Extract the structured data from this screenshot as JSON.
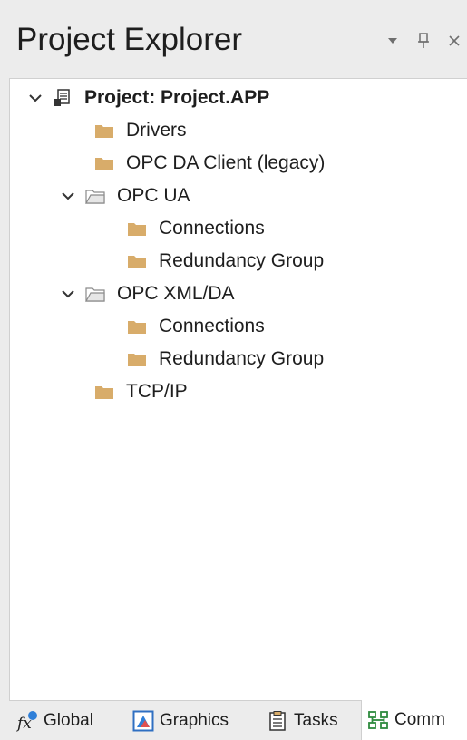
{
  "panel": {
    "title": "Project Explorer",
    "header_buttons": [
      {
        "name": "dropdown-icon"
      },
      {
        "name": "pin-icon"
      },
      {
        "name": "close-icon"
      }
    ]
  },
  "tree": {
    "root": {
      "label": "Project: Project.APP",
      "icon": "project-icon",
      "expanded": true
    },
    "items": [
      {
        "label": "Drivers",
        "icon": "folder-icon"
      },
      {
        "label": "OPC DA Client (legacy)",
        "icon": "folder-icon"
      },
      {
        "label": "OPC UA",
        "icon": "folder-open-icon",
        "expanded": true
      },
      {
        "label": "Connections",
        "icon": "folder-icon"
      },
      {
        "label": "Redundancy Group",
        "icon": "folder-icon"
      },
      {
        "label": "OPC XML/DA",
        "icon": "folder-open-icon",
        "expanded": true
      },
      {
        "label": "Connections",
        "icon": "folder-icon"
      },
      {
        "label": "Redundancy Group",
        "icon": "folder-icon"
      },
      {
        "label": "TCP/IP",
        "icon": "folder-icon"
      }
    ]
  },
  "tabs": [
    {
      "label": "Global",
      "icon": "fx-icon"
    },
    {
      "label": "Graphics",
      "icon": "graphics-icon"
    },
    {
      "label": "Tasks",
      "icon": "tasks-icon"
    },
    {
      "label": "Comm",
      "icon": "comm-icon",
      "active": true
    }
  ],
  "colors": {
    "folder": "#d8ac6a",
    "background": "#ececec",
    "tree_background": "#ffffff",
    "text": "#1e1e1e"
  }
}
